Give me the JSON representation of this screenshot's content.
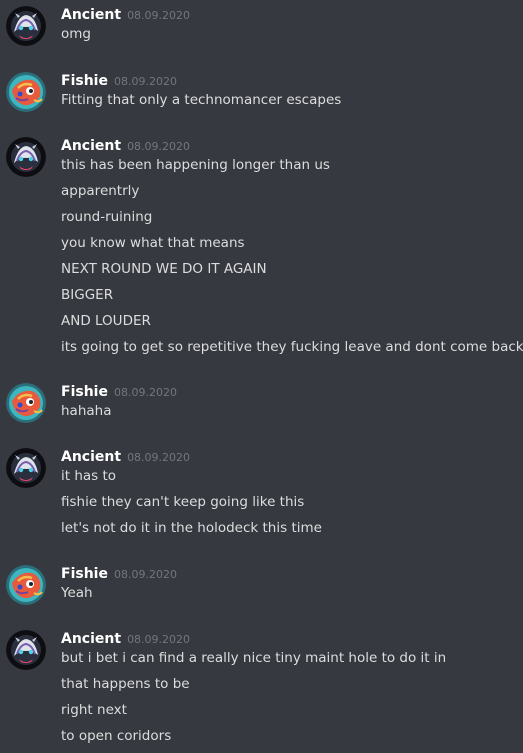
{
  "messages": [
    {
      "author": "Ancient",
      "avatar_icon": "ancient-avatar-icon",
      "timestamp": "08.09.2020",
      "lines": [
        "omg"
      ]
    },
    {
      "author": "Fishie",
      "avatar_icon": "fishie-avatar-icon",
      "timestamp": "08.09.2020",
      "lines": [
        "Fitting that only a technomancer escapes"
      ]
    },
    {
      "author": "Ancient",
      "avatar_icon": "ancient-avatar-icon",
      "timestamp": "08.09.2020",
      "lines": [
        "this has been happening longer than us",
        "apparentrly",
        "round-ruining",
        "you know what that means",
        "NEXT ROUND WE DO IT AGAIN",
        "BIGGER",
        "AND LOUDER",
        "its going to get so repetitive they fucking leave and dont come back"
      ]
    },
    {
      "author": "Fishie",
      "avatar_icon": "fishie-avatar-icon",
      "timestamp": "08.09.2020",
      "lines": [
        "hahaha"
      ]
    },
    {
      "author": "Ancient",
      "avatar_icon": "ancient-avatar-icon",
      "timestamp": "08.09.2020",
      "lines": [
        "it has to",
        "fishie they can't keep going like this",
        "let's not do it in the holodeck this time"
      ]
    },
    {
      "author": "Fishie",
      "avatar_icon": "fishie-avatar-icon",
      "timestamp": "08.09.2020",
      "lines": [
        "Yeah"
      ]
    },
    {
      "author": "Ancient",
      "avatar_icon": "ancient-avatar-icon",
      "timestamp": "08.09.2020",
      "lines": [
        "but i bet i can find a really nice tiny maint hole to do it in",
        "that happens to be",
        "right next",
        "to open coridors"
      ]
    }
  ],
  "colors": {
    "background": "#36393f",
    "username": "#ffffff",
    "timestamp": "#72767d",
    "text": "#dcddde"
  }
}
